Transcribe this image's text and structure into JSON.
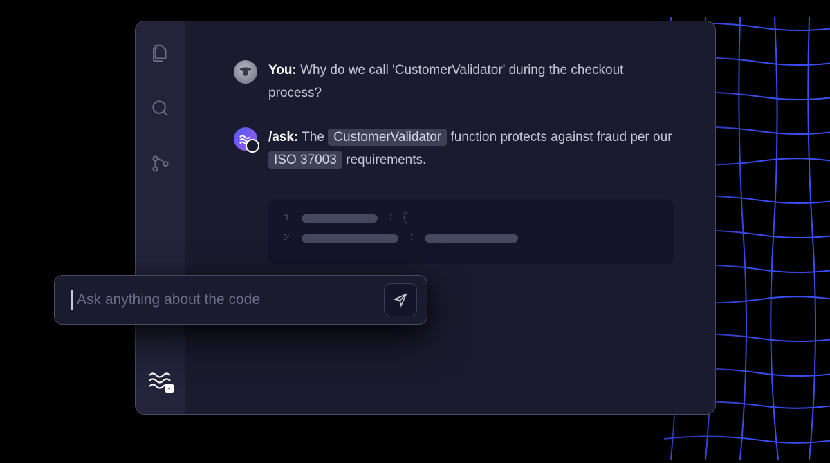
{
  "chat": {
    "user": {
      "label": "You:",
      "text": "Why do we call 'CustomerValidator' during the checkout process?"
    },
    "bot": {
      "label": "/ask:",
      "part1": "The",
      "tag1": "CustomerValidator",
      "part2": "function protects against fraud per our",
      "tag2": "ISO 37003",
      "part3": "requirements."
    }
  },
  "code": {
    "line1_num": "1",
    "line1_suffix": ": {",
    "line2_num": "2",
    "line2_suffix": ":"
  },
  "prompt": {
    "placeholder": "Ask anything about the code"
  }
}
